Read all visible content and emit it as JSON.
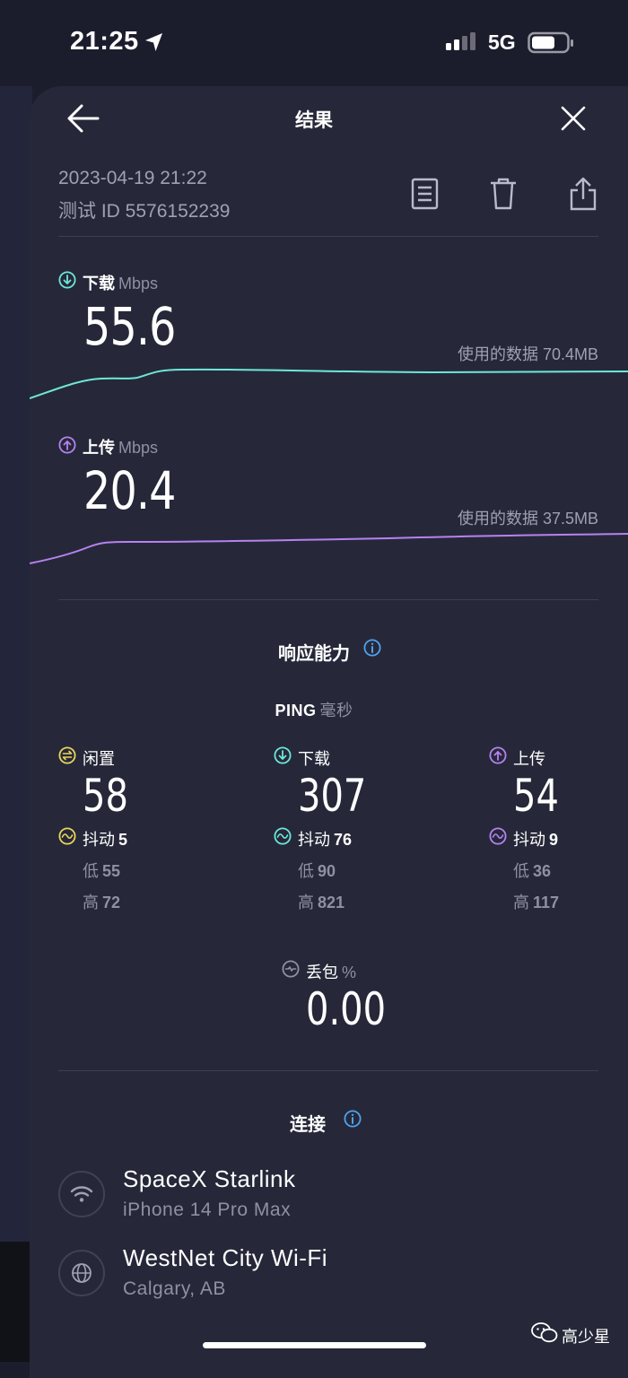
{
  "status_bar": {
    "time": "21:25",
    "network": "5G",
    "icons": [
      "location-arrow-icon",
      "signal-icon",
      "battery-icon"
    ]
  },
  "header": {
    "title": "结果",
    "back_icon": "arrow-left-icon",
    "close_icon": "close-icon"
  },
  "test_meta": {
    "datetime": "2023-04-19 21:22",
    "test_id": "测试 ID 5576152239",
    "actions": [
      "document-icon",
      "trash-icon",
      "share-icon"
    ]
  },
  "download": {
    "label": "下载",
    "unit": "Mbps",
    "value": "55.6",
    "data_used": "使用的数据 70.4MB",
    "color": "#6ee7d9"
  },
  "upload": {
    "label": "上传",
    "unit": "Mbps",
    "value": "20.4",
    "data_used": "使用的数据 37.5MB",
    "color": "#b682f0"
  },
  "responsiveness": {
    "title": "响应能力",
    "ping_label": "PING",
    "ping_unit": "毫秒",
    "columns": [
      {
        "label": "闲置",
        "value": "58",
        "jitter_label": "抖动",
        "jitter": "5",
        "low_label": "低",
        "low": "55",
        "high_label": "高",
        "high": "72",
        "color": "#e8d55a"
      },
      {
        "label": "下载",
        "value": "307",
        "jitter_label": "抖动",
        "jitter": "76",
        "low_label": "低",
        "low": "90",
        "high_label": "高",
        "high": "821",
        "color": "#6ee7d9"
      },
      {
        "label": "上传",
        "value": "54",
        "jitter_label": "抖动",
        "jitter": "9",
        "low_label": "低",
        "low": "36",
        "high_label": "高",
        "high": "117",
        "color": "#b682f0"
      }
    ],
    "packet_loss_label": "丢包",
    "packet_loss_unit": "%",
    "packet_loss": "0.00"
  },
  "connections": {
    "title": "连接",
    "items": [
      {
        "name": "SpaceX Starlink",
        "sub": "iPhone 14 Pro Max",
        "icon": "wifi-icon"
      },
      {
        "name": "WestNet City Wi-Fi",
        "sub": "Calgary, AB",
        "icon": "globe-icon"
      }
    ]
  },
  "watermark": "高少星"
}
